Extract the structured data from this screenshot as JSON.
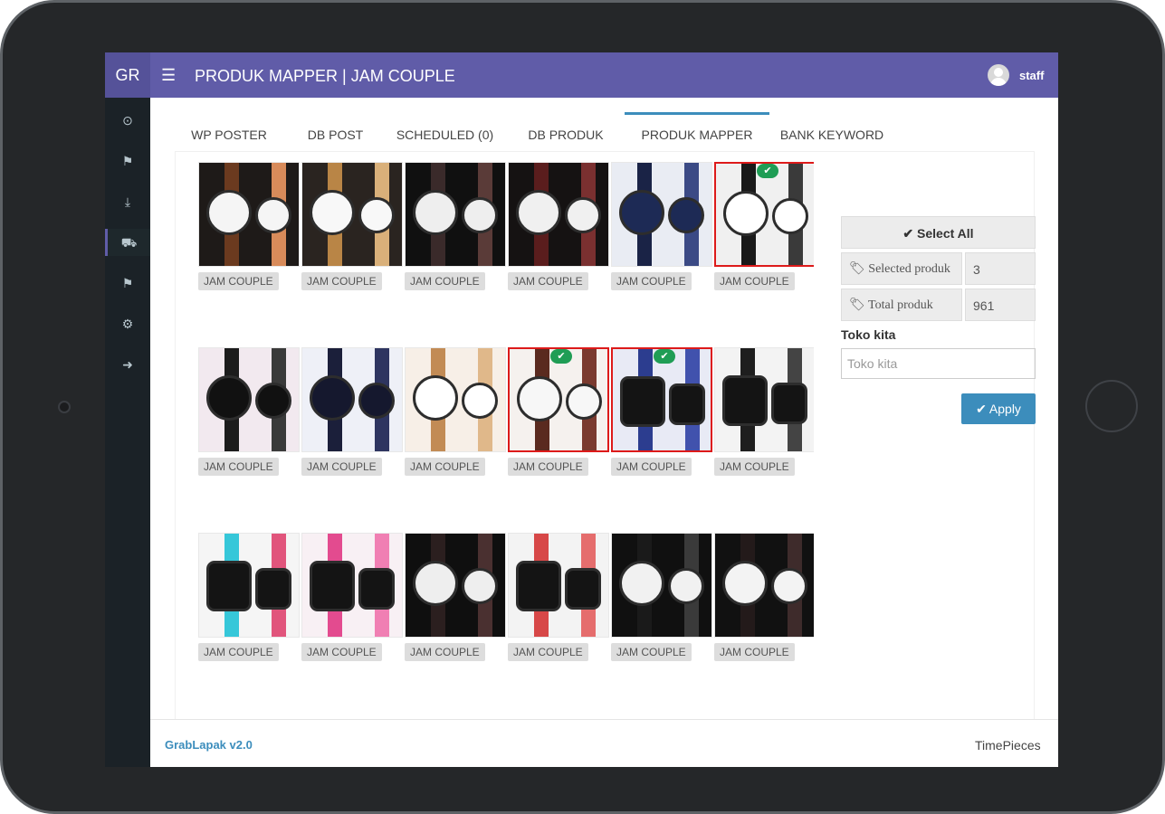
{
  "app": {
    "logo": "GR",
    "title": "PRODUK MAPPER | JAM COUPLE",
    "menu_icon": "bars-icon"
  },
  "user": {
    "name": "staff",
    "avatar_icon": "user-avatar-icon"
  },
  "sidebar": {
    "items": [
      {
        "icon": "dashboard-icon",
        "glyph": "⊙"
      },
      {
        "icon": "user-icon",
        "glyph": "⚑"
      },
      {
        "icon": "download-icon",
        "glyph": "⤓"
      },
      {
        "icon": "cart-icon",
        "glyph": "⛟",
        "active": true
      },
      {
        "icon": "user-icon",
        "glyph": "⚑"
      },
      {
        "icon": "settings-icon",
        "glyph": "⚙"
      },
      {
        "icon": "logout-icon",
        "glyph": "➜"
      }
    ]
  },
  "tabs": [
    {
      "label": "WP POSTER"
    },
    {
      "label": "DB POST"
    },
    {
      "label": "SCHEDULED (0)"
    },
    {
      "label": "DB PRODUK"
    },
    {
      "label": "PRODUK MAPPER",
      "active": true
    },
    {
      "label": "BANK KEYWORD"
    }
  ],
  "products": [
    {
      "tag": "JAM COUPLE",
      "selected": false,
      "style": "brown"
    },
    {
      "tag": "JAM COUPLE",
      "selected": false,
      "style": "tan"
    },
    {
      "tag": "JAM COUPLE",
      "selected": false,
      "style": "dark"
    },
    {
      "tag": "JAM COUPLE",
      "selected": false,
      "style": "maroon"
    },
    {
      "tag": "JAM COUPLE",
      "selected": false,
      "style": "navy"
    },
    {
      "tag": "JAM COUPLE",
      "selected": true,
      "style": "black"
    },
    {
      "tag": "JAM COUPLE",
      "selected": false,
      "style": "blackred"
    },
    {
      "tag": "JAM COUPLE",
      "selected": false,
      "style": "navy2"
    },
    {
      "tag": "JAM COUPLE",
      "selected": false,
      "style": "camel"
    },
    {
      "tag": "JAM COUPLE",
      "selected": true,
      "style": "brown2"
    },
    {
      "tag": "JAM COUPLE",
      "selected": true,
      "style": "bluesq"
    },
    {
      "tag": "JAM COUPLE",
      "selected": false,
      "style": "blacksq"
    },
    {
      "tag": "JAM COUPLE",
      "selected": false,
      "style": "cyansq"
    },
    {
      "tag": "JAM COUPLE",
      "selected": false,
      "style": "pinksq"
    },
    {
      "tag": "JAM COUPLE",
      "selected": false,
      "style": "dark2"
    },
    {
      "tag": "JAM COUPLE",
      "selected": false,
      "style": "redsq"
    },
    {
      "tag": "JAM COUPLE",
      "selected": false,
      "style": "dark3"
    },
    {
      "tag": "JAM COUPLE",
      "selected": false,
      "style": "dark4"
    }
  ],
  "actions": {
    "select_all": "✔ Select All",
    "selected_label": "Selected produk",
    "selected_value": "3",
    "total_label": "Total produk",
    "total_value": "961",
    "tag_icon": "tag-icon",
    "store_label": "Toko kita",
    "store_placeholder": "Toko kita",
    "apply_label": "✔ Apply"
  },
  "footer": {
    "brand": "GrabLapak v2.0",
    "right": "TimePieces"
  },
  "colors": {
    "header": "#605ca8",
    "sidebar": "#1b2227",
    "primary": "#3c8dbc",
    "selected_border": "#dd1a1a",
    "check": "#1f9d55"
  }
}
